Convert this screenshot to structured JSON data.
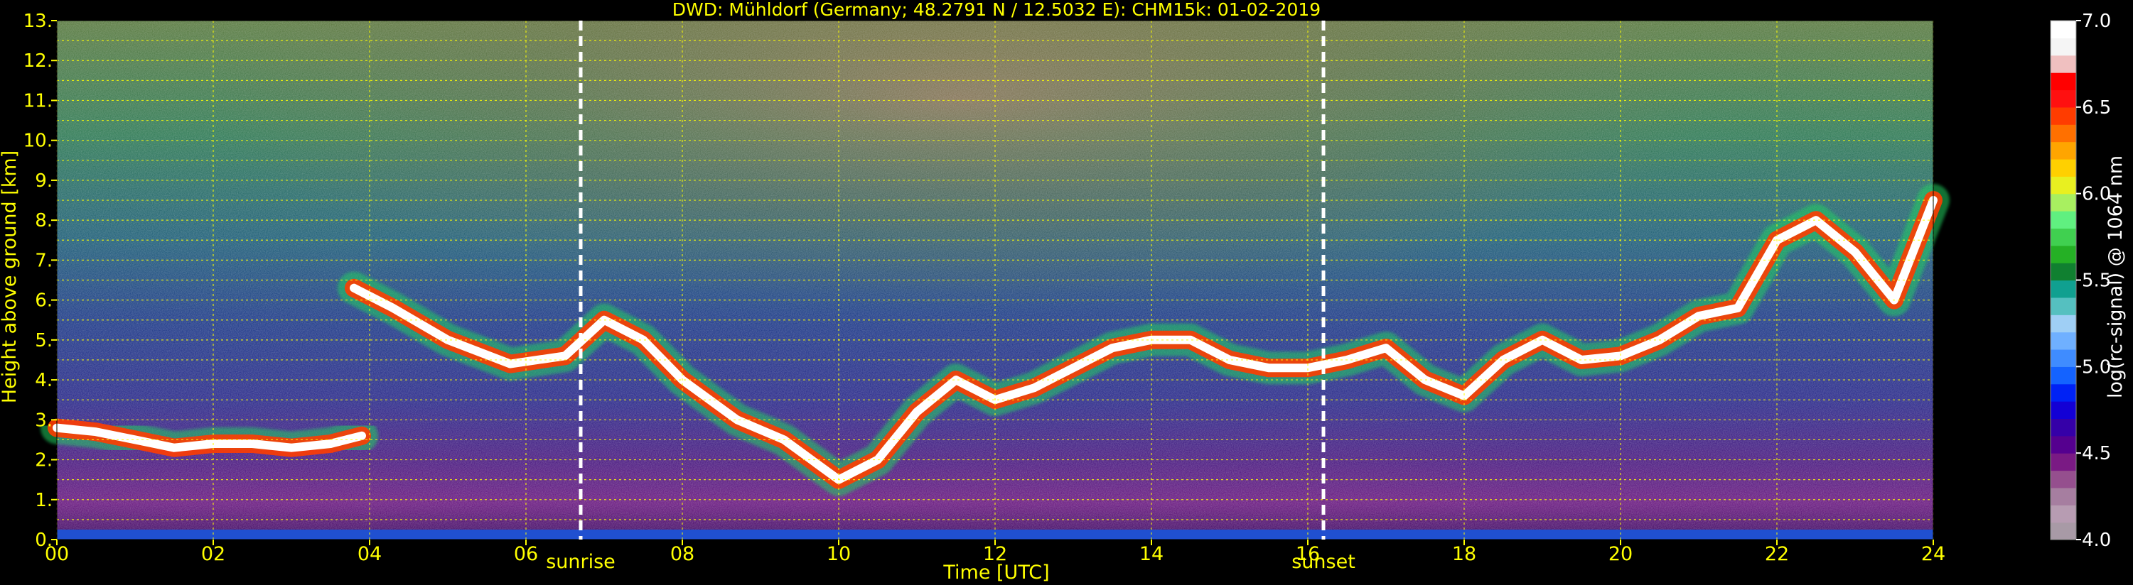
{
  "chart_data": {
    "type": "heatmap",
    "title": "DWD: Mühldorf (Germany; 48.2791 N / 12.5032 E):    CHM15k: 01-02-2019",
    "xlabel": "Time [UTC]",
    "ylabel": "Height above ground [km]",
    "xlim": [
      0,
      24
    ],
    "ylim": [
      0,
      13
    ],
    "x_ticks": [
      0,
      2,
      4,
      6,
      8,
      10,
      12,
      14,
      16,
      18,
      20,
      22,
      24
    ],
    "x_tick_labels": [
      "00",
      "02",
      "04",
      "06",
      "08",
      "10",
      "12",
      "14",
      "16",
      "18",
      "20",
      "22",
      "24"
    ],
    "y_ticks": [
      0,
      1,
      2,
      3,
      4,
      5,
      6,
      7,
      8,
      9,
      10,
      11,
      12,
      13
    ],
    "y_tick_labels": [
      "0.",
      "1.",
      "2.",
      "3.",
      "4.",
      "5.",
      "6.",
      "7.",
      "8.",
      "9.",
      "10.",
      "11.",
      "12.",
      "13."
    ],
    "grid": true,
    "grid_color": "#ffff00",
    "vertical_markers": [
      {
        "label": "sunrise",
        "x": 6.7
      },
      {
        "label": "sunset",
        "x": 16.2
      }
    ],
    "colorbar": {
      "label": "log(rc-signal) @ 1064 nm",
      "range": [
        4.0,
        7.0
      ],
      "ticks": [
        4.0,
        4.5,
        5.0,
        5.5,
        6.0,
        6.5,
        7.0
      ],
      "tick_labels": [
        "4.0",
        "4.5",
        "5.0",
        "5.5",
        "6.0",
        "6.5",
        "7.0"
      ],
      "colors": [
        "#a89aa6",
        "#b79cb2",
        "#a67ea0",
        "#954f8e",
        "#7a1a84",
        "#55008f",
        "#3500a8",
        "#1300d5",
        "#0022f5",
        "#1463ff",
        "#3f8cff",
        "#6fb0ff",
        "#9fcff5",
        "#55c0c0",
        "#10a090",
        "#108030",
        "#25b025",
        "#40d050",
        "#60f080",
        "#a8f060",
        "#e8f020",
        "#ffd000",
        "#ffa500",
        "#ff7000",
        "#ff3c00",
        "#ff1010",
        "#ff0000",
        "#f0c0c0",
        "#f5f5f5",
        "#ffffff"
      ]
    },
    "layers": [
      {
        "name": "cloud-layer-low",
        "color": "#ffffff",
        "points": [
          [
            0.0,
            2.8
          ],
          [
            0.5,
            2.7
          ],
          [
            1.0,
            2.5
          ],
          [
            1.5,
            2.3
          ],
          [
            2.0,
            2.4
          ],
          [
            2.5,
            2.4
          ],
          [
            3.0,
            2.3
          ],
          [
            3.5,
            2.4
          ],
          [
            3.9,
            2.6
          ]
        ]
      },
      {
        "name": "cloud-layer-main",
        "color": "#ff3c00",
        "points": [
          [
            3.8,
            6.3
          ],
          [
            4.3,
            5.8
          ],
          [
            5.0,
            5.0
          ],
          [
            5.8,
            4.4
          ],
          [
            6.5,
            4.6
          ],
          [
            7.0,
            5.5
          ],
          [
            7.5,
            5.0
          ],
          [
            8.0,
            4.0
          ],
          [
            8.7,
            3.0
          ],
          [
            9.3,
            2.5
          ],
          [
            10.0,
            1.5
          ],
          [
            10.5,
            2.0
          ],
          [
            11.0,
            3.2
          ],
          [
            11.5,
            4.0
          ],
          [
            12.0,
            3.5
          ],
          [
            12.5,
            3.8
          ],
          [
            13.0,
            4.3
          ],
          [
            13.5,
            4.8
          ],
          [
            14.0,
            5.0
          ],
          [
            14.5,
            5.0
          ],
          [
            15.0,
            4.5
          ],
          [
            15.5,
            4.3
          ],
          [
            16.0,
            4.3
          ],
          [
            16.5,
            4.5
          ],
          [
            17.0,
            4.8
          ],
          [
            17.5,
            4.0
          ],
          [
            18.0,
            3.6
          ],
          [
            18.5,
            4.5
          ],
          [
            19.0,
            5.0
          ],
          [
            19.5,
            4.5
          ],
          [
            20.0,
            4.6
          ],
          [
            20.5,
            5.0
          ],
          [
            21.0,
            5.6
          ],
          [
            21.5,
            5.8
          ],
          [
            22.0,
            7.5
          ],
          [
            22.5,
            8.0
          ],
          [
            23.0,
            7.2
          ],
          [
            23.5,
            6.0
          ],
          [
            24.0,
            8.5
          ]
        ]
      }
    ]
  }
}
